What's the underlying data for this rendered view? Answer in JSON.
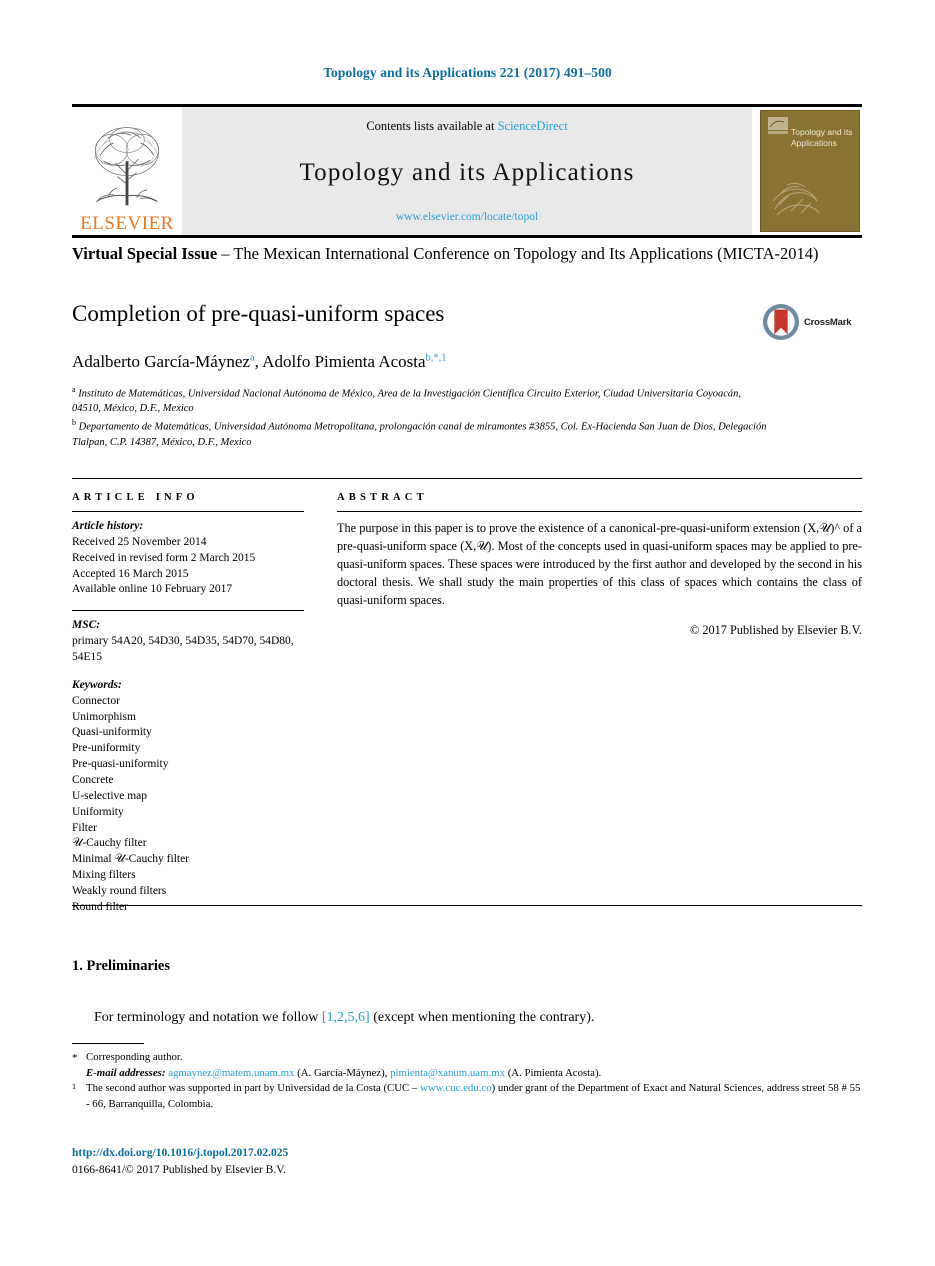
{
  "running_head": "Topology and its Applications 221 (2017) 491–500",
  "masthead": {
    "publisher_name": "ELSEVIER",
    "contents_prefix": "Contents lists available at ",
    "contents_link": "ScienceDirect",
    "journal_title": "Topology and its Applications",
    "journal_url": "www.elsevier.com/locate/topol",
    "cover_title": "Topology and its Applications"
  },
  "special_issue": {
    "bold_part": "Virtual Special Issue",
    "rest": " – The Mexican International Conference on Topology and Its Applications (MICTA-2014)"
  },
  "title": "Completion of pre-quasi-uniform spaces",
  "crossmark_label": "CrossMark",
  "authors": {
    "author1_name": "Adalberto García-Máynez",
    "author1_mark": "a",
    "separator": ", ",
    "author2_name": "Adolfo Pimienta Acosta",
    "author2_mark": "b,*,1"
  },
  "affiliations": [
    {
      "mark": "a",
      "text": "Instituto de Matemáticas, Universidad Nacional Autónoma de México, Area de la Investigación Científica Circuito Exterior, Ciudad Universitaria Coyoacán, 04510, México, D.F., Mexico"
    },
    {
      "mark": "b",
      "text": "Departamento de Matemáticas, Universidad Autónoma Metropolitana, prolongación canal de miramontes #3855, Col. Ex-Hacienda San Juan de Dios, Delegación Tlalpan, C.P. 14387, México, D.F., Mexico"
    }
  ],
  "article_info": {
    "label": "ARTICLE INFO",
    "history_head": "Article history:",
    "history": [
      "Received 25 November 2014",
      "Received in revised form 2 March 2015",
      "Accepted 16 March 2015",
      "Available online 10 February 2017"
    ],
    "msc_head": "MSC:",
    "msc": "primary 54A20, 54D30, 54D35, 54D70, 54D80, 54E15",
    "keywords_head": "Keywords:",
    "keywords": [
      "Connector",
      "Unimorphism",
      "Quasi-uniformity",
      "Pre-uniformity",
      "Pre-quasi-uniformity",
      "Concrete",
      "U-selective map",
      "Uniformity",
      "Filter",
      "𝒰-Cauchy filter",
      "Minimal 𝒰-Cauchy filter",
      "Mixing filters",
      "Weakly round filters",
      "Round filter"
    ]
  },
  "abstract": {
    "label": "ABSTRACT",
    "text": "The purpose in this paper is to prove the existence of a canonical-pre-quasi-uniform extension (X,𝒰)^ of a pre-quasi-uniform space (X,𝒰). Most of the concepts used in quasi-uniform spaces may be applied to pre-quasi-uniform spaces. These spaces were introduced by the first author and developed by the second in his doctoral thesis. We shall study the main properties of this class of spaces which contains the class of quasi-uniform spaces.",
    "copyright": "© 2017 Published by Elsevier B.V."
  },
  "body": {
    "section_heading": "1. Preliminaries",
    "paragraph_before": "For terminology and notation we follow ",
    "citation": "[1,2,5,6]",
    "paragraph_after": " (except when mentioning the contrary)."
  },
  "footnotes": {
    "corresponding_mark": "*",
    "corresponding_text": "Corresponding author.",
    "email_lead": "E-mail addresses:",
    "email1": "agmaynez@matem.unam.mx",
    "email1_owner": " (A. García-Máynez), ",
    "email2": "pimienta@xanum.uam.mx",
    "email2_owner": " (A. Pimienta Acosta).",
    "note_mark": "1",
    "note_part1": "The second author was supported in part by Universidad de la Costa (CUC – ",
    "note_link": "www.cuc.edu.co",
    "note_part2": ") under grant of the Department of Exact and Natural Sciences, address street 58 # 55 - 66, Barranquilla, Colombia."
  },
  "footer": {
    "doi": "http://dx.doi.org/10.1016/j.topol.2017.02.025",
    "issn_line": "0166-8641/© 2017 Published by Elsevier B.V."
  }
}
